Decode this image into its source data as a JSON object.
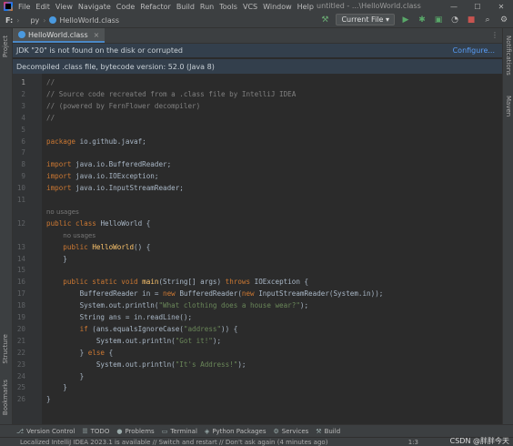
{
  "titlebar": {
    "menu": [
      "File",
      "Edit",
      "View",
      "Navigate",
      "Code",
      "Refactor",
      "Build",
      "Run",
      "Tools",
      "VCS",
      "Window",
      "Help"
    ],
    "window_title": "untitled - ...\\HelloWorld.class"
  },
  "navbar": {
    "drive": "F:",
    "folder": "py",
    "file": "HelloWorld.class",
    "run_config": "Current File"
  },
  "tab": {
    "label": "HelloWorld.class"
  },
  "left_tools": [
    "Project",
    "Structure",
    "Bookmarks"
  ],
  "right_tools": [
    "Notifications",
    "Maven"
  ],
  "banners": {
    "jdk_message": "JDK \"20\" is not found on the disk or corrupted",
    "jdk_link": "Configure...",
    "decompiled": "Decompiled .class file, bytecode version: 52.0 (Java 8)"
  },
  "code_lines": [
    {
      "n": "1",
      "tokens": [
        {
          "t": "fold",
          "v": "//"
        }
      ]
    },
    {
      "n": "2",
      "tokens": [
        {
          "t": "cmt",
          "v": "// Source code recreated from a .class file by IntelliJ IDEA"
        }
      ]
    },
    {
      "n": "3",
      "tokens": [
        {
          "t": "cmt",
          "v": "// (powered by FernFlower decompiler)"
        }
      ]
    },
    {
      "n": "4",
      "tokens": [
        {
          "t": "cmt",
          "v": "//"
        }
      ]
    },
    {
      "n": "5",
      "tokens": []
    },
    {
      "n": "6",
      "tokens": [
        {
          "t": "kw",
          "v": "package "
        },
        {
          "t": "pl",
          "v": "io.github.javaf;"
        }
      ]
    },
    {
      "n": "7",
      "tokens": []
    },
    {
      "n": "8",
      "tokens": [
        {
          "t": "kw",
          "v": "import "
        },
        {
          "t": "pl",
          "v": "java.io.BufferedReader;"
        }
      ]
    },
    {
      "n": "9",
      "tokens": [
        {
          "t": "kw",
          "v": "import "
        },
        {
          "t": "pl",
          "v": "java.io.IOException;"
        }
      ]
    },
    {
      "n": "10",
      "tokens": [
        {
          "t": "kw",
          "v": "import "
        },
        {
          "t": "pl",
          "v": "java.io.InputStreamReader;"
        }
      ]
    },
    {
      "n": "11",
      "tokens": []
    },
    {
      "n": "",
      "hint": "no usages",
      "indent": ""
    },
    {
      "n": "12",
      "tokens": [
        {
          "t": "kw",
          "v": "public class "
        },
        {
          "t": "pl",
          "v": "HelloWorld {"
        }
      ]
    },
    {
      "n": "",
      "hint": "no usages",
      "indent": "    "
    },
    {
      "n": "13",
      "tokens": [
        {
          "t": "pl",
          "v": "    "
        },
        {
          "t": "kw",
          "v": "public "
        },
        {
          "t": "fn",
          "v": "HelloWorld"
        },
        {
          "t": "pl",
          "v": "() {"
        }
      ]
    },
    {
      "n": "14",
      "tokens": [
        {
          "t": "pl",
          "v": "    }"
        }
      ]
    },
    {
      "n": "15",
      "tokens": []
    },
    {
      "n": "16",
      "tokens": [
        {
          "t": "pl",
          "v": "    "
        },
        {
          "t": "kw",
          "v": "public static void "
        },
        {
          "t": "fn",
          "v": "main"
        },
        {
          "t": "pl",
          "v": "(String[] args) "
        },
        {
          "t": "kw",
          "v": "throws "
        },
        {
          "t": "pl",
          "v": "IOException {"
        }
      ]
    },
    {
      "n": "17",
      "tokens": [
        {
          "t": "pl",
          "v": "        BufferedReader in = "
        },
        {
          "t": "kw",
          "v": "new "
        },
        {
          "t": "pl",
          "v": "BufferedReader("
        },
        {
          "t": "kw",
          "v": "new "
        },
        {
          "t": "pl",
          "v": "InputStreamReader(System.in));"
        }
      ]
    },
    {
      "n": "18",
      "tokens": [
        {
          "t": "pl",
          "v": "        System.out.println("
        },
        {
          "t": "str",
          "v": "\"What clothing does a house wear?\""
        },
        {
          "t": "pl",
          "v": ");"
        }
      ]
    },
    {
      "n": "19",
      "tokens": [
        {
          "t": "pl",
          "v": "        String ans = in.readLine();"
        }
      ]
    },
    {
      "n": "20",
      "tokens": [
        {
          "t": "pl",
          "v": "        "
        },
        {
          "t": "kw",
          "v": "if "
        },
        {
          "t": "pl",
          "v": "(ans.equalsIgnoreCase("
        },
        {
          "t": "str",
          "v": "\"address\""
        },
        {
          "t": "pl",
          "v": ")) {"
        }
      ]
    },
    {
      "n": "21",
      "tokens": [
        {
          "t": "pl",
          "v": "            System.out.println("
        },
        {
          "t": "str",
          "v": "\"Got it!\""
        },
        {
          "t": "pl",
          "v": ");"
        }
      ]
    },
    {
      "n": "22",
      "tokens": [
        {
          "t": "pl",
          "v": "        } "
        },
        {
          "t": "kw",
          "v": "else "
        },
        {
          "t": "pl",
          "v": "{"
        }
      ]
    },
    {
      "n": "23",
      "tokens": [
        {
          "t": "pl",
          "v": "            System.out.println("
        },
        {
          "t": "str",
          "v": "\"It's Address!\""
        },
        {
          "t": "pl",
          "v": ");"
        }
      ]
    },
    {
      "n": "24",
      "tokens": [
        {
          "t": "pl",
          "v": "        }"
        }
      ]
    },
    {
      "n": "25",
      "tokens": [
        {
          "t": "pl",
          "v": "    }"
        }
      ]
    },
    {
      "n": "26",
      "tokens": [
        {
          "t": "pl",
          "v": "}"
        }
      ]
    }
  ],
  "bottom_tools": [
    {
      "icon": "version-control-icon",
      "label": "Version Control"
    },
    {
      "icon": "todo-icon",
      "label": "TODO"
    },
    {
      "icon": "problems-icon",
      "label": "Problems"
    },
    {
      "icon": "terminal-icon",
      "label": "Terminal"
    },
    {
      "icon": "python-packages-icon",
      "label": "Python Packages"
    },
    {
      "icon": "services-icon",
      "label": "Services"
    },
    {
      "icon": "build-icon",
      "label": "Build"
    }
  ],
  "status": {
    "message": "Localized IntelliJ IDEA 2023.1 is available // Switch and restart // Don't ask again (4 minutes ago)",
    "position": "1:3",
    "watermark": "CSDN @胖胖今天"
  }
}
